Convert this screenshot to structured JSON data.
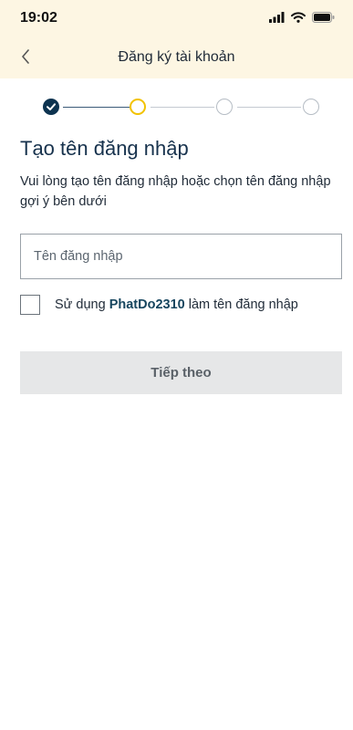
{
  "status_bar": {
    "time": "19:02"
  },
  "nav": {
    "back_icon": "chevron-left-icon",
    "title": "Đăng ký tài khoản"
  },
  "stepper": {
    "total_steps": 4,
    "current_step": 2,
    "states": [
      "done",
      "active",
      "todo",
      "todo"
    ]
  },
  "form": {
    "title": "Tạo tên đăng nhập",
    "description": "Vui lòng tạo tên đăng nhập hoặc chọn tên đăng nhập gợi ý bên dưới",
    "username": {
      "value": "",
      "placeholder": "Tên đăng nhập"
    },
    "suggestion": {
      "prefix": "Sử dụng",
      "name": "PhatDo2310",
      "suffix": "làm tên đăng nhập",
      "checked": false
    },
    "next_label": "Tiếp theo"
  },
  "colors": {
    "header_bg": "#fdf6e3",
    "primary": "#0d3350",
    "active_step": "#f2c200",
    "button_disabled_bg": "#e6e7e8"
  }
}
